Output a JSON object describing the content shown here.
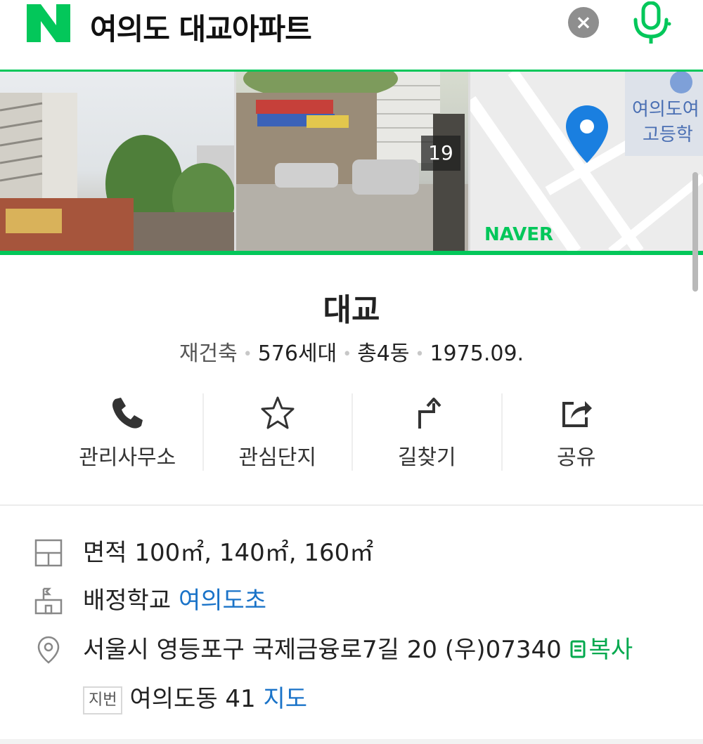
{
  "search": {
    "query": "여의도 대교아파트",
    "clear_label": "×"
  },
  "photos": {
    "count": "19",
    "map_label_1": "여의도여",
    "map_label_2": "고등학",
    "map_brand": "NAVER"
  },
  "complex": {
    "name": "대교",
    "type": "재건축",
    "households": "576세대",
    "buildings": "총4동",
    "built": "1975.09."
  },
  "actions": [
    {
      "label": "관리사무소",
      "icon": "phone-icon"
    },
    {
      "label": "관심단지",
      "icon": "star-icon"
    },
    {
      "label": "길찾기",
      "icon": "directions-icon"
    },
    {
      "label": "공유",
      "icon": "share-icon"
    }
  ],
  "info": {
    "area_label": "면적",
    "area_value": "100㎡, 140㎡, 160㎡",
    "school_label": "배정학교",
    "school_value": "여의도초",
    "address": "서울시 영등포구 국제금융로7길 20 (우)07340",
    "copy_label": "복사",
    "lot_badge": "지번",
    "lot_address": "여의도동 41",
    "map_link": "지도"
  },
  "colors": {
    "brand_green": "#03c75a",
    "link_blue": "#1a73c8"
  }
}
